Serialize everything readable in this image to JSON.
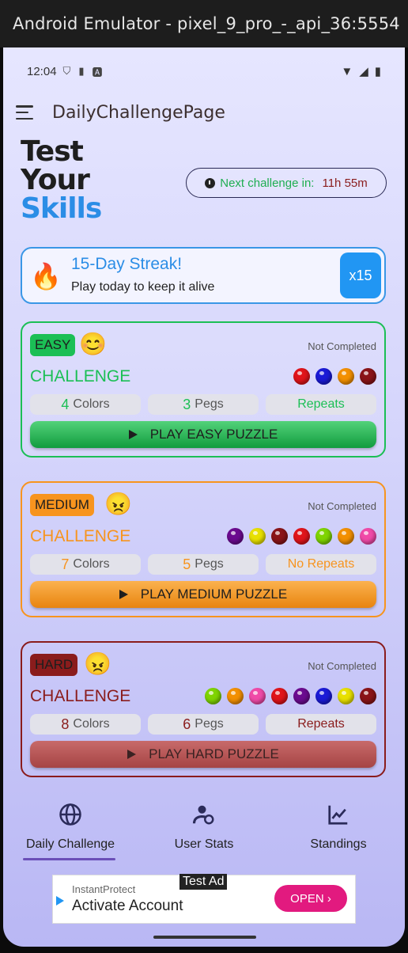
{
  "window": {
    "title": "Android Emulator - pixel_9_pro_-_api_36:5554"
  },
  "status_bar": {
    "time": "12:04"
  },
  "app_bar": {
    "title": "DailyChallengePage"
  },
  "hero": {
    "line1": "Test",
    "line2": "Your",
    "line3": "Skills"
  },
  "timer": {
    "label": "Next challenge in:",
    "value": "11h 55m"
  },
  "streak": {
    "title": "15-Day Streak!",
    "subtitle": "Play today to keep it alive",
    "multiplier": "x15"
  },
  "challenges": [
    {
      "level": "EASY",
      "face": "😊",
      "status": "Not Completed",
      "title": "CHALLENGE",
      "pegs": [
        "#e0141a",
        "#1a1ad6",
        "#f39000",
        "#8a1418"
      ],
      "colors_count": "4",
      "colors_label": "Colors",
      "pegs_count": "3",
      "pegs_label": "Pegs",
      "repeats": "Repeats",
      "play_label": "PLAY EASY PUZZLE"
    },
    {
      "level": "MEDIUM",
      "face": "😠",
      "status": "Not Completed",
      "title": "CHALLENGE",
      "pegs": [
        "#6b0a8f",
        "#e8e000",
        "#8a1418",
        "#e0141a",
        "#7fd400",
        "#f39000",
        "#f04aa8"
      ],
      "colors_count": "7",
      "colors_label": "Colors",
      "pegs_count": "5",
      "pegs_label": "Pegs",
      "repeats": "No Repeats",
      "play_label": "PLAY MEDIUM PUZZLE"
    },
    {
      "level": "HARD",
      "face": "😠",
      "status": "Not Completed",
      "title": "CHALLENGE",
      "pegs": [
        "#7fd400",
        "#f39000",
        "#f04aa8",
        "#e0141a",
        "#6b0a8f",
        "#1a1ad6",
        "#e8e000",
        "#8a1418"
      ],
      "colors_count": "8",
      "colors_label": "Colors",
      "pegs_count": "6",
      "pegs_label": "Pegs",
      "repeats": "Repeats",
      "play_label": "PLAY HARD PUZZLE"
    }
  ],
  "bottom_nav": {
    "items": [
      {
        "label": "Daily Challenge",
        "icon": "globe-icon",
        "active": true
      },
      {
        "label": "User Stats",
        "icon": "user-stats-icon",
        "active": false
      },
      {
        "label": "Standings",
        "icon": "chart-icon",
        "active": false
      }
    ]
  },
  "ad": {
    "tag": "Test Ad",
    "brand": "InstantProtect",
    "headline": "Activate Account",
    "cta": "OPEN"
  }
}
